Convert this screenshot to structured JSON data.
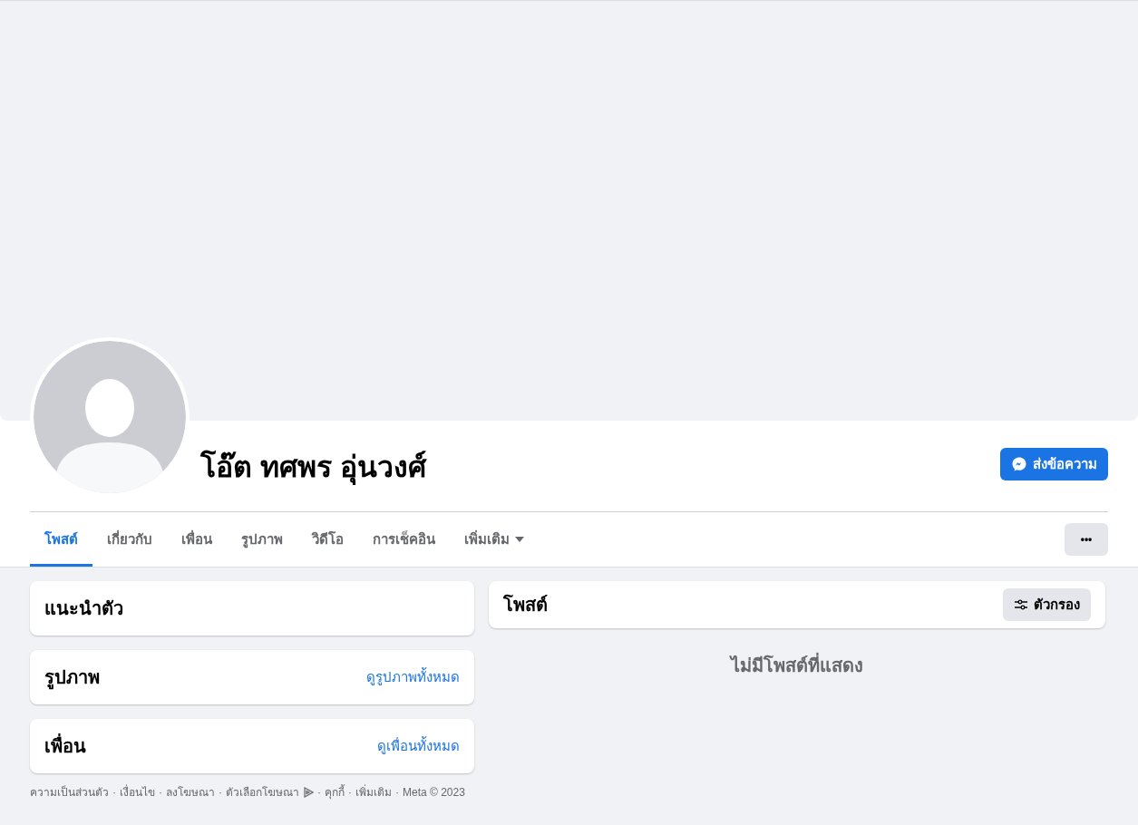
{
  "profile": {
    "name": "โอ๊ต ทศพร อุ่นวงศ์",
    "message_button": "ส่งข้อความ",
    "more_button": "•••"
  },
  "tabs": [
    {
      "label": "โพสต์",
      "selected": true,
      "kind": "plain"
    },
    {
      "label": "เกี่ยวกับ",
      "selected": false,
      "kind": "plain"
    },
    {
      "label": "เพื่อน",
      "selected": false,
      "kind": "plain"
    },
    {
      "label": "รูปภาพ",
      "selected": false,
      "kind": "plain"
    },
    {
      "label": "วิดีโอ",
      "selected": false,
      "kind": "plain"
    },
    {
      "label": "การเช็คอิน",
      "selected": false,
      "kind": "plain"
    },
    {
      "label": "เพิ่มเติม",
      "selected": false,
      "kind": "dropdown"
    }
  ],
  "left_cards": [
    {
      "title": "แนะนำตัว"
    },
    {
      "title": "รูปภาพ",
      "link": "ดูรูปภาพทั้งหมด"
    },
    {
      "title": "เพื่อน",
      "link": "ดูเพื่อนทั้งหมด"
    }
  ],
  "footer": {
    "separator": "·",
    "links": [
      {
        "label": "ความเป็นส่วนตัว",
        "kind": "plain"
      },
      {
        "label": "เงื่อนไข",
        "kind": "plain"
      },
      {
        "label": "ลงโฆษณา",
        "kind": "plain"
      },
      {
        "label": "ตัวเลือกโฆษณา",
        "kind": "ad_choices"
      },
      {
        "label": "คุกกี้",
        "kind": "plain"
      },
      {
        "label": "เพิ่มเติม",
        "kind": "plain"
      }
    ],
    "copyright": "Meta © 2023"
  },
  "posts": {
    "title": "โพสต์",
    "filter_button": "ตัวกรอง",
    "empty_message": "ไม่มีโพสต์ที่แสดง"
  }
}
